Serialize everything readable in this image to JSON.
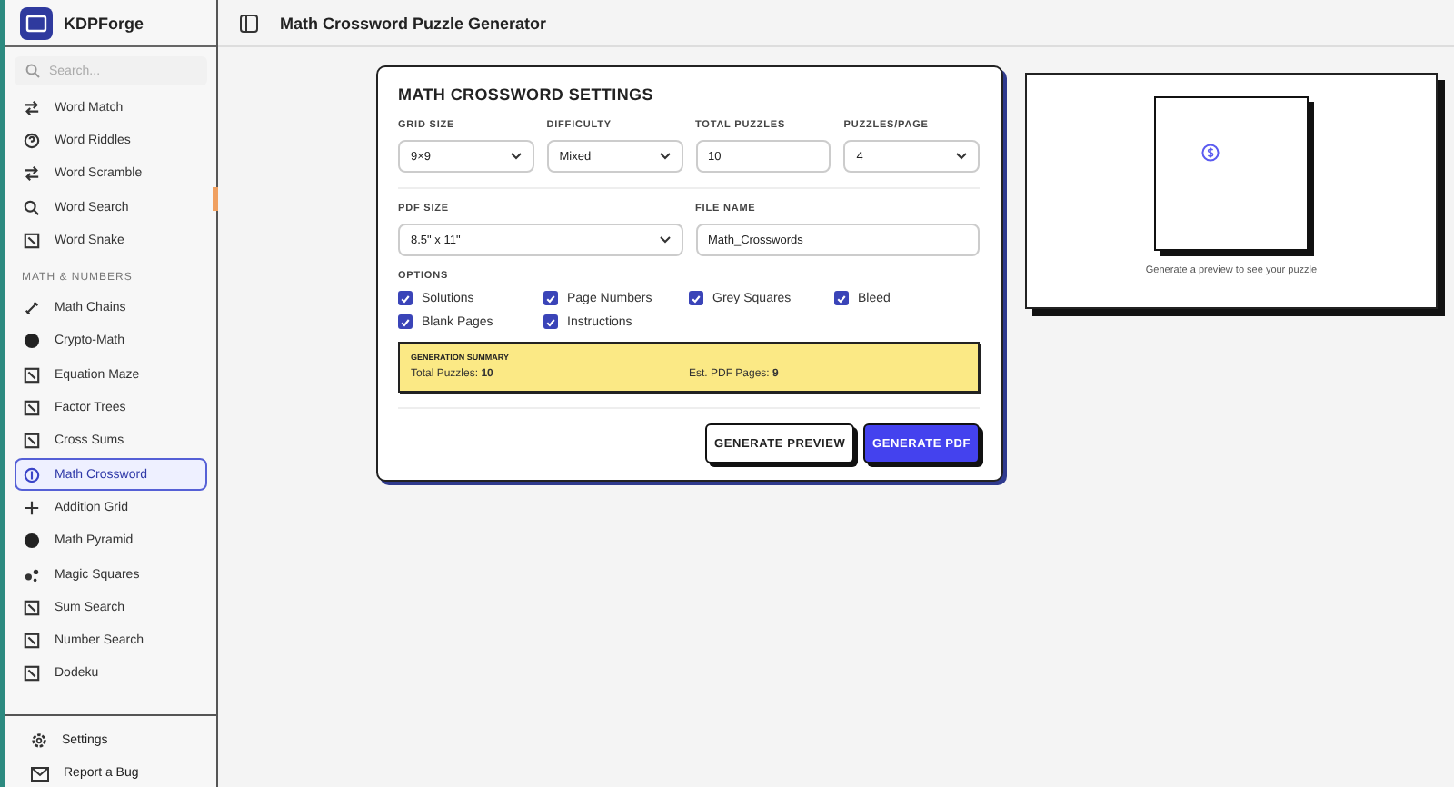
{
  "app": {
    "name": "KDPForge"
  },
  "sidebar": {
    "search": {
      "placeholder": "Search..."
    },
    "groups": [
      {
        "items": [
          {
            "label": "Word Match",
            "selected": false
          },
          {
            "label": "Word Riddles",
            "selected": false
          },
          {
            "label": "Word Scramble",
            "selected": false
          },
          {
            "label": "Word Search",
            "selected": false
          },
          {
            "label": "Word Snake",
            "selected": false
          }
        ]
      },
      {
        "heading": "MATH & NUMBERS",
        "items": [
          {
            "label": "Math Chains",
            "selected": false
          },
          {
            "label": "Crypto-Math",
            "selected": false
          },
          {
            "label": "Equation Maze",
            "selected": false
          },
          {
            "label": "Factor Trees",
            "selected": false
          },
          {
            "label": "Cross Sums",
            "selected": false
          },
          {
            "label": "Math Crossword",
            "selected": true
          },
          {
            "label": "Addition Grid",
            "selected": false
          },
          {
            "label": "Math Pyramid",
            "selected": false
          },
          {
            "label": "Magic Squares",
            "selected": false
          },
          {
            "label": "Sum Search",
            "selected": false
          },
          {
            "label": "Number Search",
            "selected": false
          },
          {
            "label": "Dodeku",
            "selected": false
          }
        ]
      }
    ],
    "footer": [
      "Settings",
      "Report a Bug"
    ]
  },
  "header": {
    "title": "Math Crossword Puzzle Generator"
  },
  "settings": {
    "title": "MATH CROSSWORD SETTINGS",
    "row1": [
      {
        "label": "GRID SIZE",
        "kind": "select",
        "value": "9×9"
      },
      {
        "label": "DIFFICULTY",
        "kind": "select",
        "value": "Mixed"
      },
      {
        "label": "TOTAL PUZZLES",
        "kind": "input",
        "value": "10"
      },
      {
        "label": "PUZZLES/PAGE",
        "kind": "select",
        "value": "4"
      }
    ],
    "row2": [
      {
        "label": "PDF SIZE",
        "kind": "select",
        "value": "8.5\" x 11\""
      },
      {
        "label": "FILE NAME",
        "kind": "input",
        "value": "Math_Crosswords"
      }
    ],
    "options_label": "OPTIONS",
    "options": [
      {
        "label": "Solutions",
        "checked": true
      },
      {
        "label": "Page Numbers",
        "checked": true
      },
      {
        "label": "Grey Squares",
        "checked": true
      },
      {
        "label": "Bleed",
        "checked": true
      },
      {
        "label": "Blank Pages",
        "checked": true
      },
      {
        "label": "Instructions",
        "checked": true
      }
    ],
    "summary": {
      "title": "GENERATION SUMMARY",
      "items": [
        {
          "label": "Total Puzzles:",
          "value": "10"
        },
        {
          "label": "Est. PDF Pages:",
          "value": "9"
        }
      ]
    },
    "buttons": [
      {
        "label": "GENERATE PREVIEW",
        "kind": "secondary"
      },
      {
        "label": "GENERATE PDF",
        "kind": "primary"
      }
    ]
  },
  "preview": {
    "message": "Generate a preview to see your puzzle"
  }
}
